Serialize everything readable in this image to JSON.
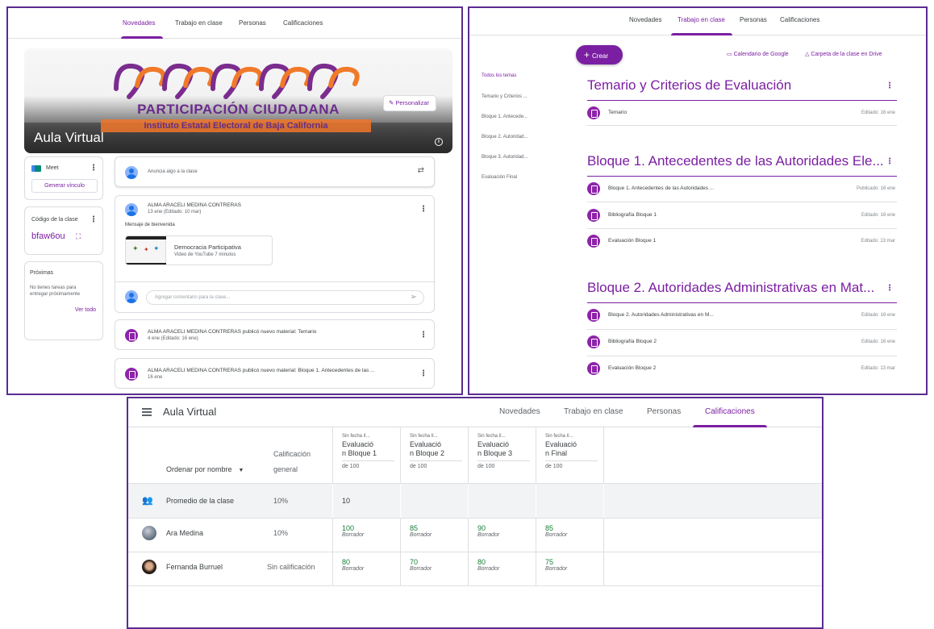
{
  "novedades_panel": {
    "tabs": [
      "Novedades",
      "Trabajo en clase",
      "Personas",
      "Calificaciones"
    ],
    "banner": {
      "class_name": "Aula Virtual",
      "logo_title": "PARTICIPACIÓN CIUDADANA",
      "logo_subtitle": "Instituto Estatal Electoral de Baja California",
      "customize_button": "Personalizar"
    },
    "meet": {
      "label": "Meet",
      "link_button": "Generar vínculo"
    },
    "class_code": {
      "label": "Código de la clase",
      "code": "bfaw6ou"
    },
    "upcoming": {
      "title": "Próximas",
      "text": "No tienes tareas para entregar próximamente",
      "link": "Ver todo"
    },
    "announce_placeholder": "Anuncia algo a la clase",
    "posts": [
      {
        "author": "ALMA ARACELI MEDINA CONTRERAS",
        "date": "13 ene (Editado: 10 mar)",
        "text": "Mensaje de bienvenida",
        "attachment_title": "Democracia Participativa",
        "attachment_meta": "Video de YouTube  7 minutos",
        "comment_placeholder": "Agregar comentario para la clase..."
      },
      {
        "title": "ALMA ARACELI MEDINA CONTRERAS publicó nuevo material: Temario",
        "date": "4 ene (Editado: 16 ene)"
      },
      {
        "title": "ALMA ARACELI MEDINA CONTRERAS publicó nuevo material: Bloque 1. Antecedentes de las ...",
        "date": "16 ene"
      }
    ]
  },
  "trabajo_panel": {
    "tabs": [
      "Novedades",
      "Trabajo en clase",
      "Personas",
      "Calificaciones"
    ],
    "create_button": "Crear",
    "calendar_link": "Calendario de Google",
    "drive_link": "Carpeta de la clase en Drive",
    "sidebar": [
      "Todos los temas",
      "Temario y Criterios ...",
      "Bloque 1. Antecede...",
      "Bloque 2. Autoridad...",
      "Bloque 3. Autoridad...",
      "Evaluación Final"
    ],
    "topics": [
      {
        "title": "Temario y Criterios de Evaluación",
        "items": [
          {
            "name": "Temario",
            "date": "Editado: 16 ene"
          }
        ]
      },
      {
        "title": "Bloque 1. Antecedentes de las Autoridades Ele...",
        "items": [
          {
            "name": "Bloque 1. Antecedentes de las Autoridades ...",
            "date": "Publicado: 16 ene"
          },
          {
            "name": "Bibliografía Bloque 1",
            "date": "Editado: 16 ene"
          },
          {
            "name": "Evaluación Bloque 1",
            "date": "Editado: 13 mar"
          }
        ]
      },
      {
        "title": "Bloque 2. Autoridades Administrativas en Mat...",
        "items": [
          {
            "name": "Bloque 2. Autoridades Administrativas en M...",
            "date": "Editado: 16 ene"
          },
          {
            "name": "Bibliografía Bloque 2",
            "date": "Editado: 16 ene"
          },
          {
            "name": "Evaluación Bloque 2",
            "date": "Editado: 13 mar"
          }
        ]
      }
    ]
  },
  "grades_panel": {
    "title": "Aula Virtual",
    "tabs": [
      "Novedades",
      "Trabajo en clase",
      "Personas",
      "Calificaciones"
    ],
    "sort_label": "Ordenar por nombre",
    "overall_header": [
      "Calificación",
      "general"
    ],
    "columns": [
      {
        "due": "Sin fecha lí...",
        "name": [
          "Evaluació",
          "n Bloque 1"
        ],
        "points": "de 100"
      },
      {
        "due": "Sin fecha lí...",
        "name": [
          "Evaluació",
          "n Bloque 2"
        ],
        "points": "de 100"
      },
      {
        "due": "Sin fecha lí...",
        "name": [
          "Evaluació",
          "n Bloque 3"
        ],
        "points": "de 100"
      },
      {
        "due": "Sin fecha lí...",
        "name": [
          "Evaluació",
          "n Final"
        ],
        "points": "de 100"
      }
    ],
    "average_row": {
      "label": "Promedio de la clase",
      "overall": "10%",
      "values": [
        "10",
        "",
        "",
        ""
      ]
    },
    "students": [
      {
        "name": "Ara Medina",
        "overall": "10%",
        "grades": [
          "100",
          "85",
          "90",
          "85"
        ],
        "status": "Borrador"
      },
      {
        "name": "Fernanda Burruel",
        "overall": "Sin calificación",
        "grades": [
          "80",
          "70",
          "80",
          "75"
        ],
        "status": "Borrador"
      }
    ],
    "accent_color": "#7b1fa2",
    "grade_color": "#188038"
  }
}
